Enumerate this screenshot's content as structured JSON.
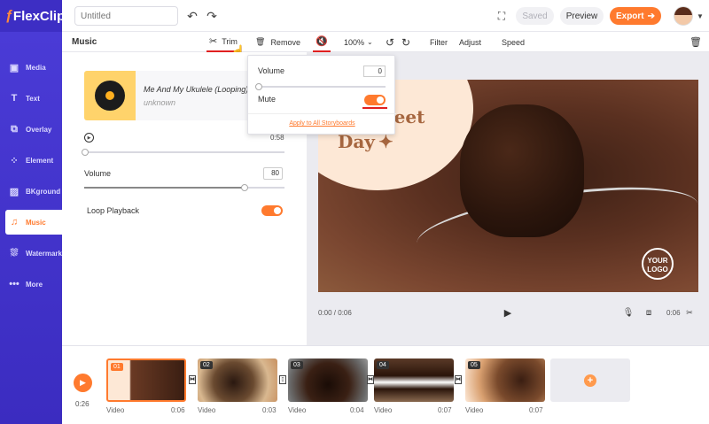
{
  "app": {
    "logo_main": "Flex",
    "logo_accent": "Clip",
    "title_placeholder": "Untitled",
    "saved_label": "Saved",
    "preview_label": "Preview",
    "export_label": "Export"
  },
  "sidebar": {
    "items": [
      {
        "label": "Media",
        "icon": "media-icon"
      },
      {
        "label": "Text",
        "icon": "text-icon"
      },
      {
        "label": "Overlay",
        "icon": "overlay-icon"
      },
      {
        "label": "Element",
        "icon": "element-icon"
      },
      {
        "label": "BKground",
        "icon": "background-icon"
      },
      {
        "label": "Music",
        "icon": "music-icon"
      },
      {
        "label": "Watermark",
        "icon": "watermark-icon"
      },
      {
        "label": "More",
        "icon": "more-icon"
      }
    ]
  },
  "toolbar": {
    "section_title": "Music",
    "trim_label": "Trim",
    "remove_label": "Remove",
    "zoom": "100%",
    "filter_label": "Filter",
    "adjust_label": "Adjust",
    "speed_label": "Speed"
  },
  "music": {
    "track_title": "Me And My Ukulele (Looping)",
    "artist": "unknown",
    "duration": "0:58",
    "volume_label": "Volume",
    "volume_value": "80",
    "loop_label": "Loop Playback",
    "loop_on": true,
    "volume_fraction": 0.8
  },
  "mute_popup": {
    "volume_label": "Volume",
    "volume_value": "0",
    "mute_label": "Mute",
    "mute_on": true,
    "apply_label": "Apply to All Storyboards"
  },
  "preview": {
    "heading_line1": "Sweet",
    "heading_line2": "Day",
    "logo_line1": "YOUR",
    "logo_line2": "LOGO",
    "time_current": "0:00 / 0:06",
    "time_total": "0:06"
  },
  "timeline": {
    "play_time": "0:26",
    "clips": [
      {
        "num": "01",
        "type": "Video",
        "dur": "0:06"
      },
      {
        "num": "02",
        "type": "Video",
        "dur": "0:03"
      },
      {
        "num": "03",
        "type": "Video",
        "dur": "0:04"
      },
      {
        "num": "04",
        "type": "Video",
        "dur": "0:07"
      },
      {
        "num": "05",
        "type": "Video",
        "dur": "0:07"
      }
    ]
  },
  "colors": {
    "brand": "#3d2ec4",
    "accent": "#ff7a2e"
  }
}
